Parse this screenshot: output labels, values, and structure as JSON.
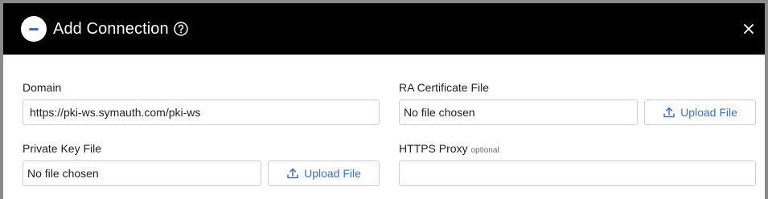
{
  "dialog": {
    "title": "Add Connection",
    "help_icon": "help-circle-icon",
    "close_icon": "close-icon",
    "logo": "brand-logo"
  },
  "form": {
    "domain": {
      "label": "Domain",
      "value": "https://pki-ws.symauth.com/pki-ws"
    },
    "ra_certificate": {
      "label": "RA Certificate File",
      "file_status": "No file chosen",
      "upload_label": "Upload File"
    },
    "private_key": {
      "label": "Private Key File",
      "file_status": "No file chosen",
      "upload_label": "Upload File"
    },
    "https_proxy": {
      "label": "HTTPS Proxy",
      "optional_tag": "optional",
      "value": ""
    }
  },
  "colors": {
    "header_bg": "#000000",
    "accent": "#3a6fd8",
    "border": "#cfcfcf"
  }
}
